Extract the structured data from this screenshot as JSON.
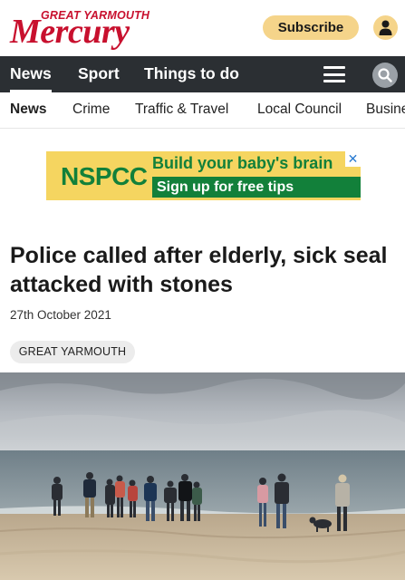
{
  "header": {
    "logo_small": "GREAT YARMOUTH",
    "logo_big": "Mercury",
    "subscribe_label": "Subscribe",
    "account_icon": "user-icon"
  },
  "nav": {
    "items": [
      {
        "label": "News",
        "active": true
      },
      {
        "label": "Sport",
        "active": false
      },
      {
        "label": "Things to do",
        "active": false
      }
    ],
    "menu_icon": "hamburger-icon",
    "search_icon": "search-icon"
  },
  "subnav": {
    "items": [
      {
        "label": "News"
      },
      {
        "label": "Crime"
      },
      {
        "label": "Traffic & Travel"
      },
      {
        "label": "Local Council"
      },
      {
        "label": "Business"
      }
    ]
  },
  "ad": {
    "brand": "NSPCC",
    "headline": "Build your baby's brain",
    "cta": "Sign up for free tips",
    "close": "✕"
  },
  "article": {
    "headline": "Police called after elderly, sick seal attacked with stones",
    "date": "27th October 2021",
    "tag": "GREAT YARMOUTH"
  },
  "colors": {
    "brand_red": "#c8102e",
    "nav_bg": "#2b2f33",
    "subscribe_bg": "#f5d48a",
    "ad_yellow": "#f5d560",
    "ad_green": "#12803a"
  }
}
